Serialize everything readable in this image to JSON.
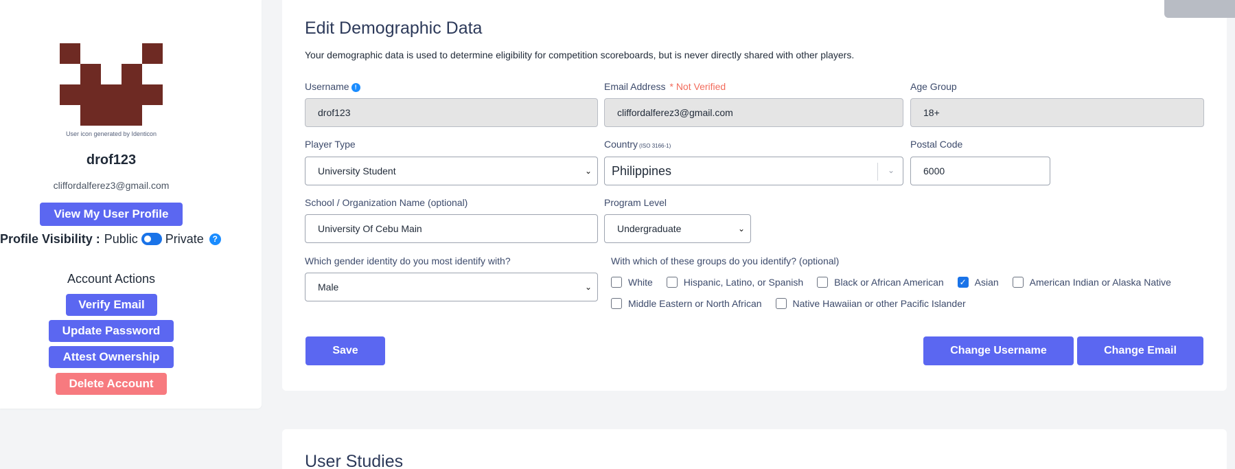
{
  "profile": {
    "identicon_credit": "User icon generated by Identicon",
    "username": "drof123",
    "email": "cliffordalferez3@gmail.com",
    "view_profile_label": "View My User Profile",
    "visibility_label": "Profile Visibility :",
    "visibility_public": "Public",
    "visibility_private": "Private",
    "help_glyph": "?",
    "identicon_color": "#6e2a23"
  },
  "account_actions": {
    "title": "Account Actions",
    "verify_email": "Verify Email",
    "update_password": "Update Password",
    "attest_ownership": "Attest Ownership",
    "delete_account": "Delete Account"
  },
  "demographic": {
    "title": "Edit Demographic Data",
    "description": "Your demographic data is used to determine eligibility for competition scoreboards, but is never directly shared with other players.",
    "username_label": "Username",
    "username_value": "drof123",
    "email_label": "Email Address",
    "email_status": "* Not Verified",
    "email_value": "cliffordalferez3@gmail.com",
    "age_label": "Age Group",
    "age_value": "18+",
    "player_type_label": "Player Type",
    "player_type_value": "University Student",
    "country_label": "Country",
    "country_note": "(ISO 3166-1)",
    "country_value": "Philippines",
    "postal_label": "Postal Code",
    "postal_value": "6000",
    "school_label": "School / Organization Name (optional)",
    "school_value": "University Of Cebu Main",
    "program_label": "Program Level",
    "program_value": "Undergraduate",
    "gender_label": "Which gender identity do you most identify with?",
    "gender_value": "Male",
    "groups_label": "With which of these groups do you identify? (optional)",
    "groups": [
      {
        "label": "White",
        "checked": false
      },
      {
        "label": "Hispanic, Latino, or Spanish",
        "checked": false
      },
      {
        "label": "Black or African American",
        "checked": false
      },
      {
        "label": "Asian",
        "checked": true
      },
      {
        "label": "American Indian or Alaska Native",
        "checked": false
      },
      {
        "label": "Middle Eastern or North African",
        "checked": false
      },
      {
        "label": "Native Hawaiian or other Pacific Islander",
        "checked": false
      }
    ],
    "save_label": "Save",
    "change_username_label": "Change Username",
    "change_email_label": "Change Email"
  },
  "studies": {
    "title": "User Studies"
  },
  "colors": {
    "primary": "#5b67f1",
    "danger": "#f77a7f",
    "not_verified": "#f26b5b",
    "toggle": "#1a73e8"
  }
}
